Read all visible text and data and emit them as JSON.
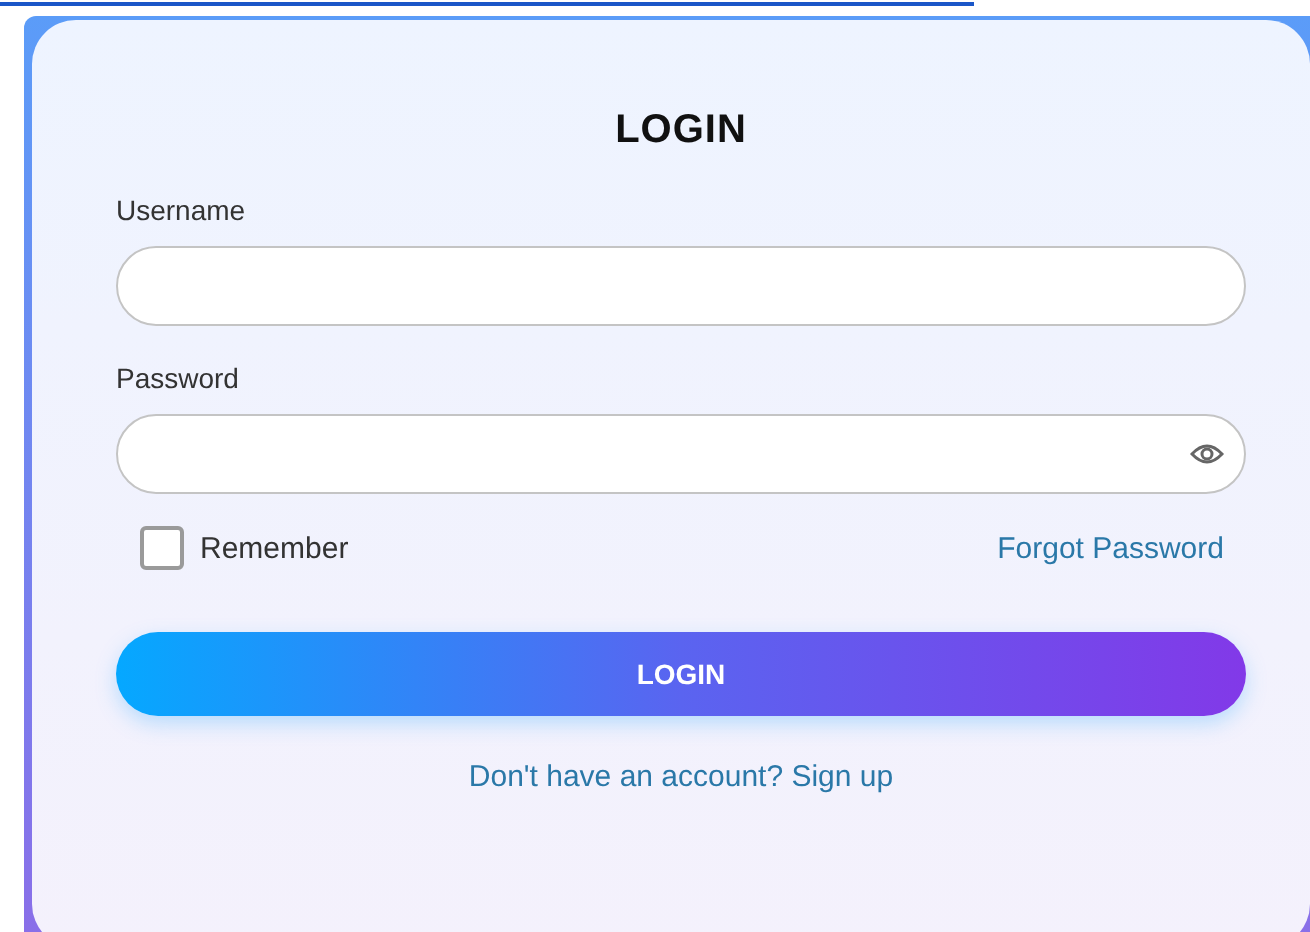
{
  "title": "LOGIN",
  "fields": [
    {
      "label": "Username",
      "kind": "text"
    },
    {
      "label": "Password",
      "kind": "password"
    }
  ],
  "remember": {
    "label": "Remember",
    "checked": false
  },
  "forgot_link": "Forgot Password",
  "submit": "LOGIN",
  "signup_link": "Don't have an account? Sign up"
}
